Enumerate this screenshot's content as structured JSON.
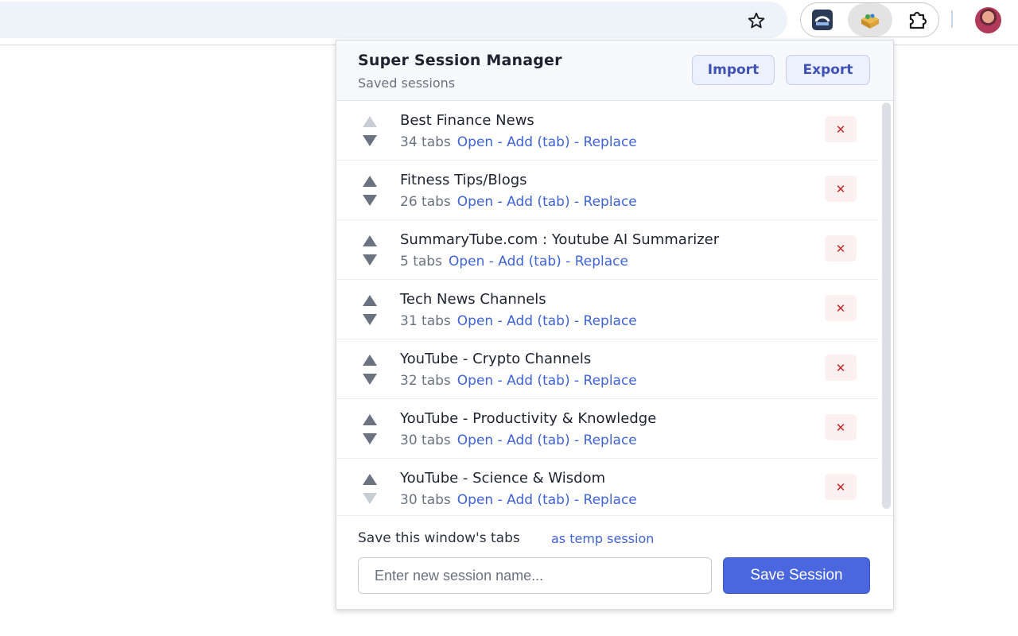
{
  "browser": {
    "icons": [
      "bookmark-star-icon",
      "extension-icon-1",
      "super-session-manager-icon",
      "extensions-puzzle-icon",
      "profile-avatar"
    ]
  },
  "popup": {
    "title": "Super Session Manager",
    "subtitle": "Saved sessions",
    "import_label": "Import",
    "export_label": "Export",
    "sessions": [
      {
        "name": "Best Finance News",
        "tabs": "34 tabs",
        "actions": "Open - Add (tab) - Replace",
        "up_disabled": true,
        "down_disabled": false
      },
      {
        "name": "Fitness Tips/Blogs",
        "tabs": "26 tabs",
        "actions": "Open - Add (tab) - Replace",
        "up_disabled": false,
        "down_disabled": false
      },
      {
        "name": "SummaryTube.com : Youtube AI Summarizer",
        "tabs": "5 tabs",
        "actions": "Open - Add (tab) - Replace",
        "up_disabled": false,
        "down_disabled": false
      },
      {
        "name": "Tech News Channels",
        "tabs": "31 tabs",
        "actions": "Open - Add (tab) - Replace",
        "up_disabled": false,
        "down_disabled": false
      },
      {
        "name": "YouTube - Crypto Channels",
        "tabs": "32 tabs",
        "actions": "Open - Add (tab) - Replace",
        "up_disabled": false,
        "down_disabled": false
      },
      {
        "name": "YouTube - Productivity & Knowledge",
        "tabs": "30 tabs",
        "actions": "Open - Add (tab) - Replace",
        "up_disabled": false,
        "down_disabled": false
      },
      {
        "name": "YouTube - Science & Wisdom",
        "tabs": "30 tabs",
        "actions": "Open - Add (tab) - Replace",
        "up_disabled": false,
        "down_disabled": true
      }
    ],
    "delete_symbol": "✕",
    "footer": {
      "label": "Save this window's tabs",
      "temp_link": "as temp session",
      "input_placeholder": "Enter new session name...",
      "input_value": "",
      "save_label": "Save Session"
    }
  },
  "colors": {
    "accent": "#4a67e0",
    "link": "#3f63d8",
    "delete": "#c62828"
  }
}
